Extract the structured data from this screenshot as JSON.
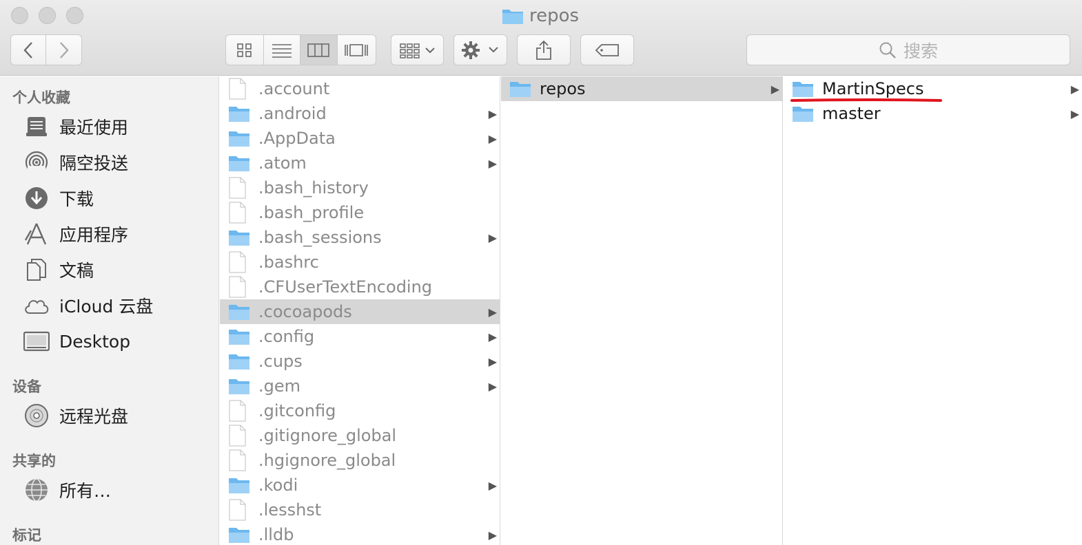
{
  "window": {
    "title": "repos"
  },
  "toolbar": {
    "back_glyph": "‹",
    "forward_glyph": "›",
    "view_modes": [
      "icon-view",
      "list-view",
      "column-view",
      "gallery-view"
    ],
    "active_view": "column-view",
    "search_placeholder": "搜索"
  },
  "sidebar": {
    "sections": [
      {
        "heading": "个人收藏",
        "items": [
          {
            "label": "最近使用",
            "icon": "recents-icon"
          },
          {
            "label": "隔空投送",
            "icon": "airdrop-icon"
          },
          {
            "label": "下载",
            "icon": "downloads-icon"
          },
          {
            "label": "应用程序",
            "icon": "applications-icon"
          },
          {
            "label": "文稿",
            "icon": "documents-icon"
          },
          {
            "label": "iCloud 云盘",
            "icon": "icloud-icon"
          },
          {
            "label": "Desktop",
            "icon": "desktop-icon"
          }
        ]
      },
      {
        "heading": "设备",
        "items": [
          {
            "label": "远程光盘",
            "icon": "remote-disc-icon"
          }
        ]
      },
      {
        "heading": "共享的",
        "items": [
          {
            "label": "所有…",
            "icon": "network-icon"
          }
        ]
      },
      {
        "heading": "标记",
        "items": []
      }
    ]
  },
  "columns": [
    {
      "items": [
        {
          "name": ".account",
          "type": "file"
        },
        {
          "name": ".android",
          "type": "folder"
        },
        {
          "name": ".AppData",
          "type": "folder"
        },
        {
          "name": ".atom",
          "type": "folder"
        },
        {
          "name": ".bash_history",
          "type": "file"
        },
        {
          "name": ".bash_profile",
          "type": "file"
        },
        {
          "name": ".bash_sessions",
          "type": "folder"
        },
        {
          "name": ".bashrc",
          "type": "file"
        },
        {
          "name": ".CFUserTextEncoding",
          "type": "file"
        },
        {
          "name": ".cocoapods",
          "type": "folder",
          "selected": true
        },
        {
          "name": ".config",
          "type": "folder"
        },
        {
          "name": ".cups",
          "type": "folder"
        },
        {
          "name": ".gem",
          "type": "folder"
        },
        {
          "name": ".gitconfig",
          "type": "file"
        },
        {
          "name": ".gitignore_global",
          "type": "file"
        },
        {
          "name": ".hgignore_global",
          "type": "file"
        },
        {
          "name": ".kodi",
          "type": "folder"
        },
        {
          "name": ".lesshst",
          "type": "file"
        },
        {
          "name": ".lldb",
          "type": "folder"
        }
      ]
    },
    {
      "items": [
        {
          "name": "repos",
          "type": "folder",
          "selected": true
        }
      ]
    },
    {
      "items": [
        {
          "name": "MartinSpecs",
          "type": "folder",
          "annotated": true
        },
        {
          "name": "master",
          "type": "folder"
        }
      ]
    }
  ],
  "colors": {
    "folder": "#6cb8ef",
    "annotation": "#e0141e",
    "selection": "#d6d6d6"
  }
}
